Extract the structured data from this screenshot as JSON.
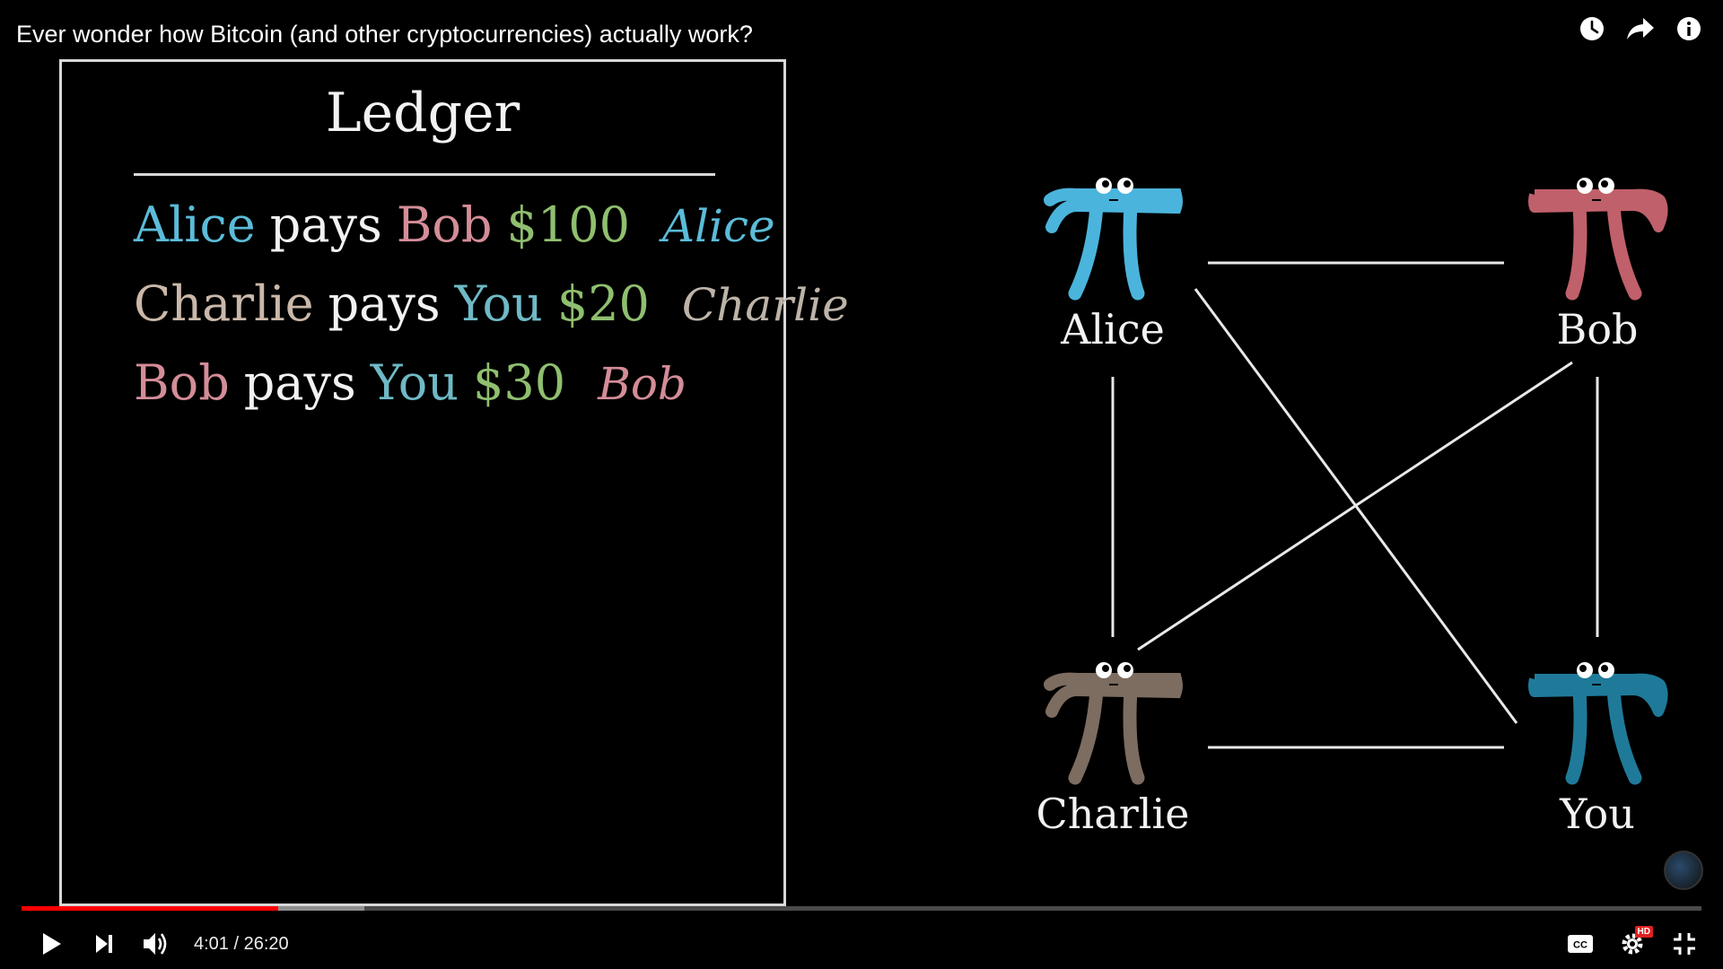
{
  "video": {
    "title": "Ever wonder how Bitcoin (and other cryptocurrencies) actually work?",
    "current_time": "4:01",
    "duration": "26:20",
    "time_display": "4:01 / 26:20",
    "progress_played_fraction": 0.153,
    "progress_loaded_fraction": 0.204
  },
  "top_actions": [
    {
      "name": "watch-later-icon"
    },
    {
      "name": "share-icon"
    },
    {
      "name": "info-icon"
    }
  ],
  "ledger": {
    "title": "Ledger",
    "entries": [
      {
        "payer": "Alice",
        "verb": "pays",
        "payee": "Bob",
        "amount": "$100",
        "signature": "Alice"
      },
      {
        "payer": "Charlie",
        "verb": "pays",
        "payee": "You",
        "amount": "$20",
        "signature": "Charlie"
      },
      {
        "payer": "Bob",
        "verb": "pays",
        "payee": "You",
        "amount": "$30",
        "signature": "Bob"
      }
    ]
  },
  "network": {
    "nodes": [
      {
        "label": "Alice",
        "color": "#4bb4dc"
      },
      {
        "label": "Bob",
        "color": "#c0606a"
      },
      {
        "label": "Charlie",
        "color": "#7d6c60"
      },
      {
        "label": "You",
        "color": "#1f7a9a"
      }
    ]
  },
  "controls": {
    "hd_badge": "HD",
    "cc_label": "CC"
  },
  "colors": {
    "progress_played": "#ff0000",
    "alice": "#5bbcd9",
    "bob": "#d48d98",
    "charlie": "#c9b8aa",
    "you": "#6fb9c6",
    "amount": "#8fbf6f"
  }
}
